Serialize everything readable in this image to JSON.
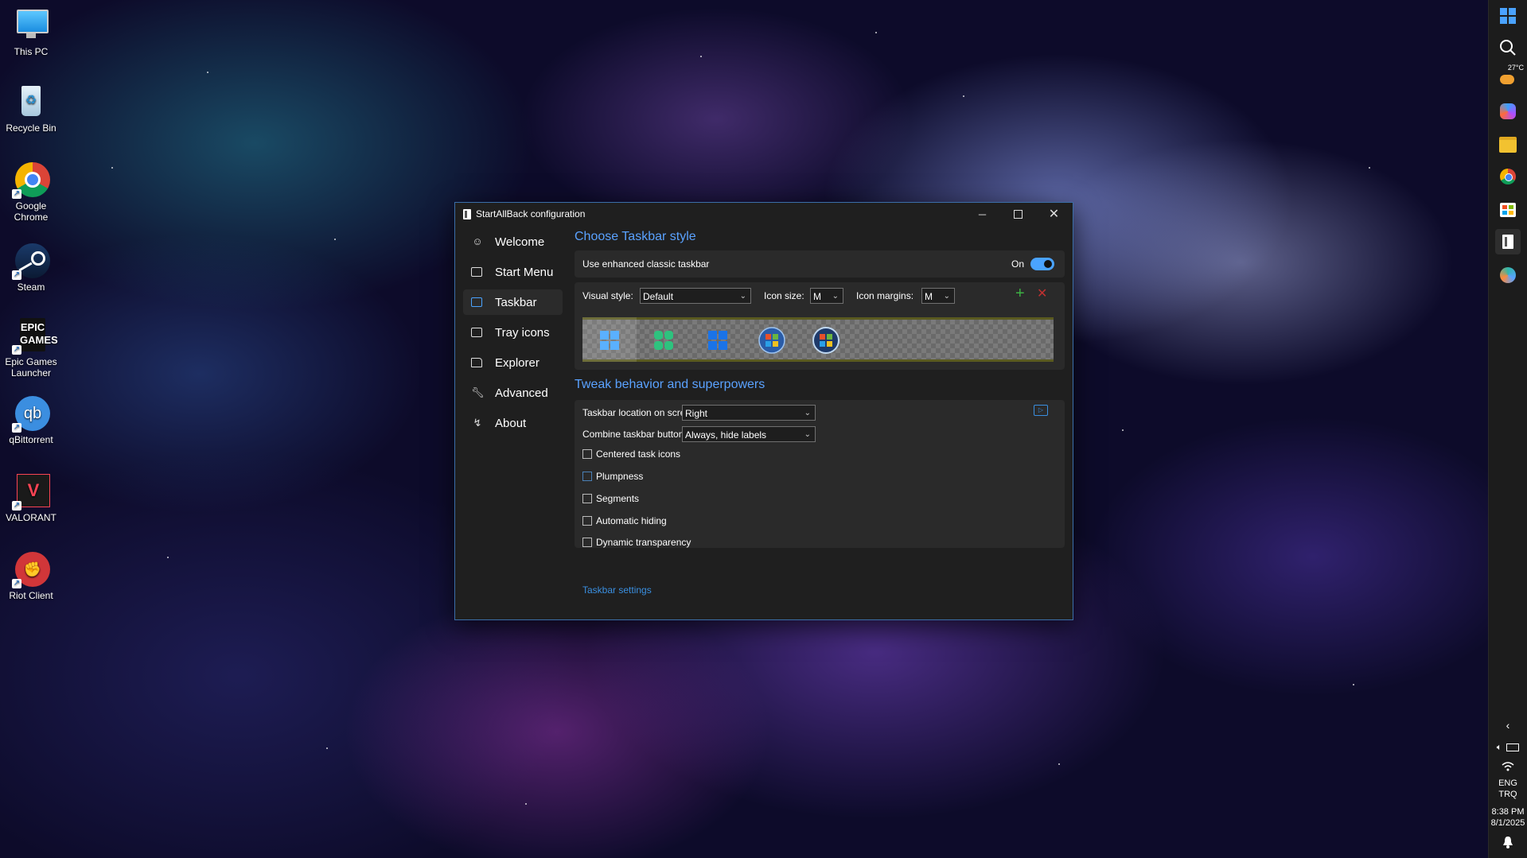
{
  "desktop": {
    "icons": [
      {
        "label": "This PC",
        "icon": "monitor-icon"
      },
      {
        "label": "Recycle Bin",
        "icon": "recycle-bin-icon"
      },
      {
        "label": "Google Chrome",
        "icon": "chrome-icon"
      },
      {
        "label": "Steam",
        "icon": "steam-icon"
      },
      {
        "label": "Epic Games Launcher",
        "icon": "epic-games-icon",
        "logo_text": "EPIC GAMES"
      },
      {
        "label": "qBittorrent",
        "icon": "qbittorrent-icon",
        "logo_text": "qb"
      },
      {
        "label": "VALORANT",
        "icon": "valorant-icon"
      },
      {
        "label": "Riot Client",
        "icon": "riot-client-icon"
      }
    ]
  },
  "taskbar": {
    "weather": "27°C",
    "language": "ENG",
    "layout": "TRQ",
    "time": "8:38 PM",
    "date": "8/1/2025",
    "items": [
      "start-icon",
      "search-icon",
      "weather-icon",
      "copilot-icon",
      "file-explorer-icon",
      "chrome-icon",
      "store-icon",
      "startallback-icon",
      "browser-icon"
    ]
  },
  "window": {
    "title": "StartAllBack configuration",
    "nav": [
      {
        "label": "Welcome",
        "icon": "smile-icon"
      },
      {
        "label": "Start Menu",
        "icon": "start-menu-icon"
      },
      {
        "label": "Taskbar",
        "icon": "taskbar-icon",
        "selected": true
      },
      {
        "label": "Tray icons",
        "icon": "tray-icon"
      },
      {
        "label": "Explorer",
        "icon": "folder-icon"
      },
      {
        "label": "Advanced",
        "icon": "wrench-icon"
      },
      {
        "label": "About",
        "icon": "about-icon"
      }
    ],
    "section1": {
      "title": "Choose Taskbar style",
      "enhanced_label": "Use enhanced classic taskbar",
      "enhanced_state": "On",
      "visual_style_label": "Visual style:",
      "visual_style_value": "Default",
      "icon_size_label": "Icon size:",
      "icon_size_value": "M",
      "icon_margins_label": "Icon margins:",
      "icon_margins_value": "M"
    },
    "section2": {
      "title": "Tweak behavior and superpowers",
      "location_label": "Taskbar location on screen:",
      "location_value": "Right",
      "combine_label": "Combine taskbar buttons:",
      "combine_value": "Always, hide labels",
      "checkboxes": [
        {
          "label": "Centered task icons",
          "checked": false
        },
        {
          "label": "Plumpness",
          "checked": false
        },
        {
          "label": "Segments",
          "checked": false
        },
        {
          "label": "Automatic hiding",
          "checked": false
        },
        {
          "label": "Dynamic transparency",
          "checked": false
        }
      ],
      "link": "Taskbar settings"
    },
    "colors": {
      "accent": "#5aa2ff",
      "window_bg": "#1f1f1f",
      "card_bg": "#2a2a2a"
    }
  }
}
